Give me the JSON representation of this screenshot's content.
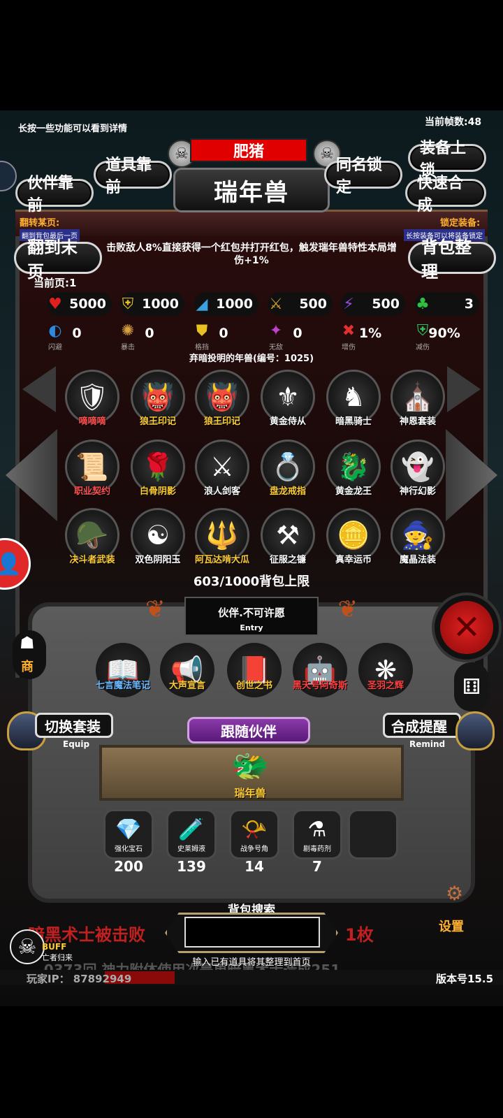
{
  "top_hint": "长按一些功能可以看到详情",
  "fps_text": "当前帧数:48",
  "pet_name": "肥猪",
  "title": "瑞年兽",
  "buttons": {
    "item_front": "道具靠前",
    "partner_front": "伙伴靠前",
    "same_name_lock": "同名锁定",
    "equip_lock": "装备上锁",
    "quick_combine": "快速合成",
    "to_last_page": "翻到末页",
    "bag_sort": "背包整理"
  },
  "flip_hint": {
    "title": "翻转某页:",
    "desc": "翻到背包最后一页"
  },
  "lock_hint": {
    "title": "锁定装备:",
    "desc": "长按装备可以将装备锁定"
  },
  "description": "击败敌人8%直接获得一个红包并打开红包，触发瑞年兽特性本局增伤+1%",
  "current_page": "当前页:1",
  "stats_row1": [
    {
      "icon": "heart-icon",
      "glyph": "♥",
      "color": "#e02020",
      "value": "5000"
    },
    {
      "icon": "armor-icon",
      "glyph": "⛨",
      "color": "#e8c020",
      "value": "1000"
    },
    {
      "icon": "boot-icon",
      "glyph": "◢",
      "color": "#3aa0e0",
      "value": "1000"
    },
    {
      "icon": "sword-icon",
      "glyph": "⚔",
      "color": "#d4a030",
      "value": "500"
    },
    {
      "icon": "lightning-icon",
      "glyph": "⚡",
      "color": "#9b4be0",
      "value": "500"
    },
    {
      "icon": "clover-icon",
      "glyph": "♣",
      "color": "#30c040",
      "value": "3"
    }
  ],
  "stats_row2": [
    {
      "icon": "dodge-icon",
      "glyph": "◐",
      "color": "#2a8ae0",
      "value": "0",
      "label": "闪避"
    },
    {
      "icon": "crit-icon",
      "glyph": "✺",
      "color": "#d8a040",
      "value": "0",
      "label": "暴击"
    },
    {
      "icon": "block-icon",
      "glyph": "⛊",
      "color": "#e8c020",
      "value": "0",
      "label": "格挡"
    },
    {
      "icon": "invincible-icon",
      "glyph": "✦",
      "color": "#c040d0",
      "value": "0",
      "label": "无敌"
    },
    {
      "icon": "damage-up-icon",
      "glyph": "✖",
      "color": "#e03030",
      "value": "1%",
      "label": "增伤"
    },
    {
      "icon": "damage-down-icon",
      "glyph": "⛨",
      "color": "#30c060",
      "value": "90%",
      "label": "减伤"
    }
  ],
  "item_source": "弃暗投明的年兽(编号：1025)",
  "grid_items": [
    {
      "label": "嘀嘀嘀",
      "glyph": "🛡",
      "color": "#ff5050"
    },
    {
      "label": "狼王印记",
      "glyph": "👹",
      "color": "#ffcc33"
    },
    {
      "label": "狼王印记",
      "glyph": "👹",
      "color": "#ffcc33"
    },
    {
      "label": "黄金侍从",
      "glyph": "⚜",
      "color": "#ffffff"
    },
    {
      "label": "暗黑骑士",
      "glyph": "♞",
      "color": "#ffffff"
    },
    {
      "label": "神恩套装",
      "glyph": "⛪",
      "color": "#ffffff"
    },
    {
      "label": "职业契约",
      "glyph": "📜",
      "color": "#ff5050"
    },
    {
      "label": "白骨阴影",
      "glyph": "🌹",
      "color": "#ffcc33"
    },
    {
      "label": "浪人剑客",
      "glyph": "⚔",
      "color": "#ffffff"
    },
    {
      "label": "盘龙戒指",
      "glyph": "💍",
      "color": "#ffcc33"
    },
    {
      "label": "黄金龙王",
      "glyph": "🐉",
      "color": "#ffffff"
    },
    {
      "label": "神行幻影",
      "glyph": "👻",
      "color": "#ffffff"
    },
    {
      "label": "决斗者武装",
      "glyph": "🪖",
      "color": "#ffcc33"
    },
    {
      "label": "双色阴阳玉",
      "glyph": "☯",
      "color": "#ffffff"
    },
    {
      "label": "阿瓦达啃大瓜",
      "glyph": "🔱",
      "color": "#ffcc33"
    },
    {
      "label": "征服之镰",
      "glyph": "⚒",
      "color": "#ffffff"
    },
    {
      "label": "真幸运币",
      "glyph": "🪙",
      "color": "#ffffff"
    },
    {
      "label": "魔晶法装",
      "glyph": "🧙",
      "color": "#ffffff"
    }
  ],
  "bag_limit": "603/1000背包上限",
  "entry": {
    "title": "伙伴.不可许愿",
    "subtitle": "Entry"
  },
  "entry_items": [
    {
      "label": "七言魔法笔记",
      "glyph": "📖",
      "color": "#6ab8ff"
    },
    {
      "label": "大声宣言",
      "glyph": "📢",
      "color": "#ffcc33"
    },
    {
      "label": "创世之书",
      "glyph": "📕",
      "color": "#ffcc33"
    },
    {
      "label": "黑天号阿奇斯",
      "glyph": "🤖",
      "color": "#ff4040"
    },
    {
      "label": "圣羽之辉",
      "glyph": "❋",
      "color": "#ff4040"
    }
  ],
  "switch_set": {
    "label": "切换套装",
    "sub": "Equip"
  },
  "combine_remind": {
    "label": "合成提醒",
    "sub": "Remind"
  },
  "follow_partner": "跟随伙伴",
  "partner": {
    "label": "瑞年兽",
    "glyph": "🐲"
  },
  "consumables": [
    {
      "label": "强化宝石",
      "glyph": "💎",
      "count": "200"
    },
    {
      "label": "史莱姆液",
      "glyph": "🧪",
      "count": "139"
    },
    {
      "label": "战争号角",
      "glyph": "📯",
      "count": "14"
    },
    {
      "label": "剧毒药剂",
      "glyph": "⚗",
      "count": "7"
    }
  ],
  "bag_search": {
    "title": "背包搜索",
    "placeholder": "",
    "hint": "输入已有道具将其整理到首页"
  },
  "ticker": {
    "left": "暗黑术士被击败",
    "right": "1枚",
    "bottom": "...0373回 神力附体使用次是更暗黑术士造成251..."
  },
  "buff": {
    "label": "BUFF",
    "sub": "亡者归来"
  },
  "player_ip": "玩家IP： 87892949",
  "version": "版本号15.5",
  "side": {
    "shop": "商",
    "settings": "设置"
  }
}
